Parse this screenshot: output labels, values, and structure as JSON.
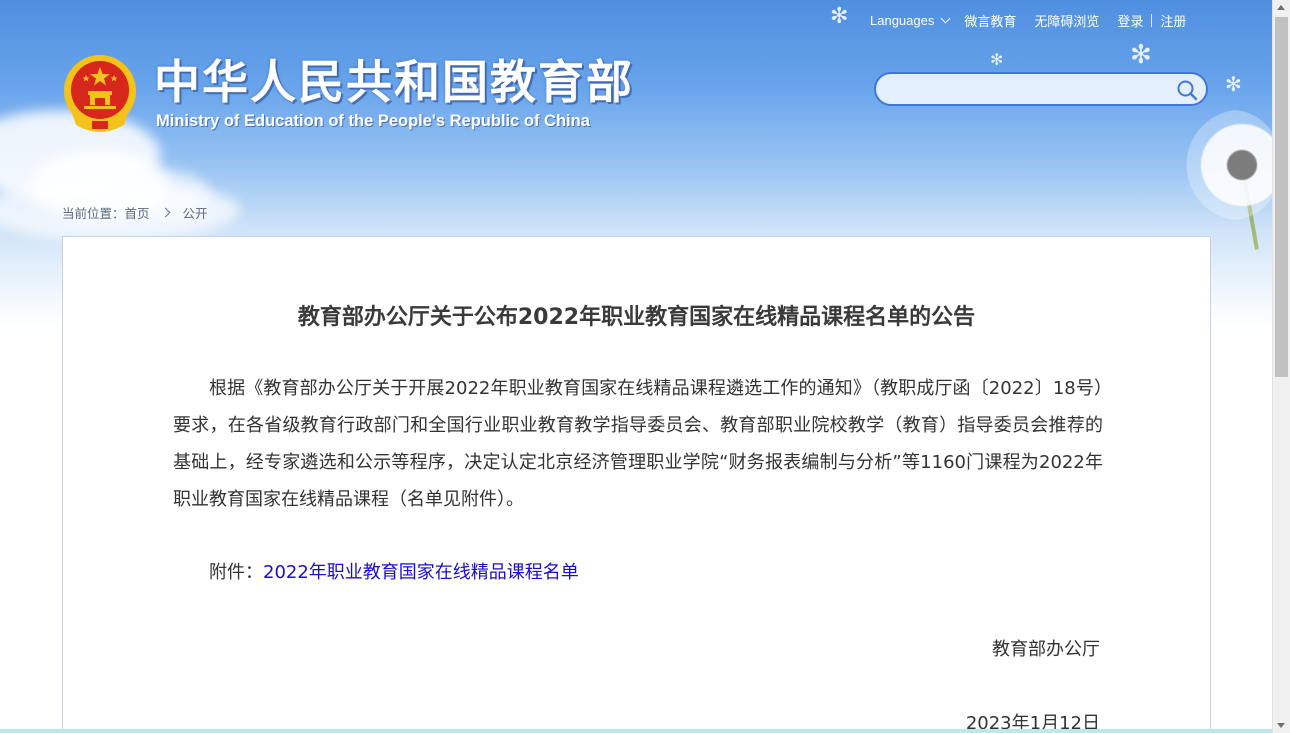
{
  "top_links": {
    "languages": "Languages",
    "weiyan": "微言教育",
    "accessibility": "无障碍浏览",
    "login": "登录",
    "register": "注册"
  },
  "header": {
    "title": "中华人民共和国教育部",
    "subtitle": "Ministry of Education of the People's Republic of China"
  },
  "search": {
    "placeholder": "",
    "value": ""
  },
  "breadcrumb": {
    "prefix": "当前位置：",
    "home": "首页",
    "current": "公开"
  },
  "article": {
    "title": "教育部办公厅关于公布2022年职业教育国家在线精品课程名单的公告",
    "body": "根据《教育部办公厅关于开展2022年职业教育国家在线精品课程遴选工作的通知》（教职成厅函〔2022〕18号）要求，在各省级教育行政部门和全国行业职业教育教学指导委员会、教育部职业院校教学（教育）指导委员会推荐的基础上，经专家遴选和公示等程序，决定认定北京经济管理职业学院“财务报表编制与分析”等1160门课程为2022年职业教育国家在线精品课程（名单见附件）。",
    "attachment_label": "附件：",
    "attachment_link": "2022年职业教育国家在线精品课程名单",
    "signature_org": "教育部办公厅",
    "signature_date": "2023年1月12日"
  },
  "colors": {
    "sky_top": "#4f8fe0",
    "link_blue": "#1a0dcc",
    "emblem_red": "#d7261c",
    "emblem_gold": "#f5c21b"
  },
  "icons": [
    "search-icon",
    "chevron-down-icon",
    "breadcrumb-arrow-icon",
    "national-emblem"
  ]
}
